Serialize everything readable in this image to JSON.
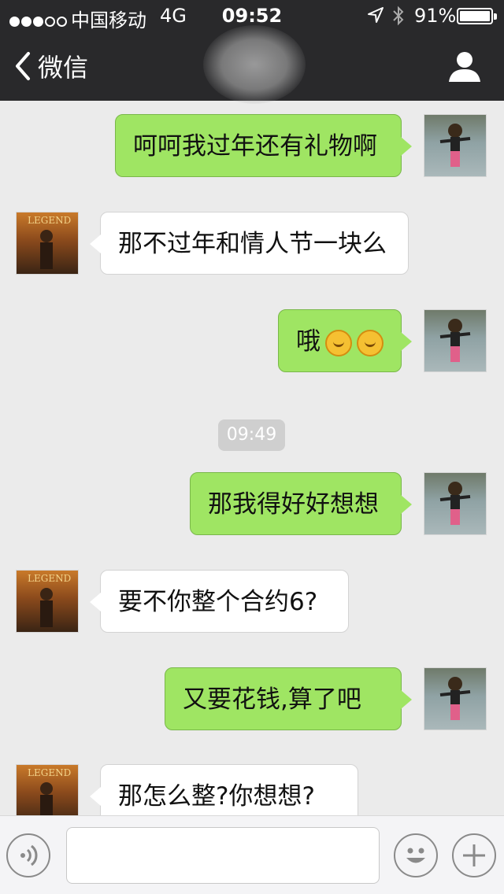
{
  "status_bar": {
    "signal_dots": [
      true,
      true,
      true,
      false,
      false
    ],
    "carrier": "中国移动",
    "network": "4G",
    "time": "09:52",
    "battery_percent": "91%",
    "battery_level": 0.91
  },
  "nav": {
    "back_label": "微信"
  },
  "colors": {
    "nav_background": "#29292b",
    "chat_background": "#ebebeb",
    "outgoing_bubble": "#9fe563",
    "incoming_bubble": "#ffffff"
  },
  "messages": [
    {
      "direction": "out",
      "text": "呵呵我过年还有礼物啊",
      "avatar": "girl-avatar"
    },
    {
      "direction": "in",
      "text": "那不过年和情人节一块么",
      "avatar": "legend-avatar"
    },
    {
      "direction": "out",
      "text": "哦",
      "emoji_count": 2,
      "emoji": "hugging-face-emoji",
      "avatar": "girl-avatar"
    },
    {
      "direction": "out",
      "text": "那我得好好想想",
      "avatar": "girl-avatar"
    },
    {
      "direction": "in",
      "text": "要不你整个合约6?",
      "avatar": "legend-avatar"
    },
    {
      "direction": "out",
      "text": "又要花钱,算了吧",
      "avatar": "girl-avatar"
    },
    {
      "direction": "in",
      "text": "那怎么整?你想想?",
      "avatar": "legend-avatar"
    }
  ],
  "timestamp": "09:49",
  "input_bar": {
    "value": "",
    "voice_icon": "voice-icon",
    "emoji_icon": "smiley-icon",
    "plus_icon": "plus-icon"
  }
}
